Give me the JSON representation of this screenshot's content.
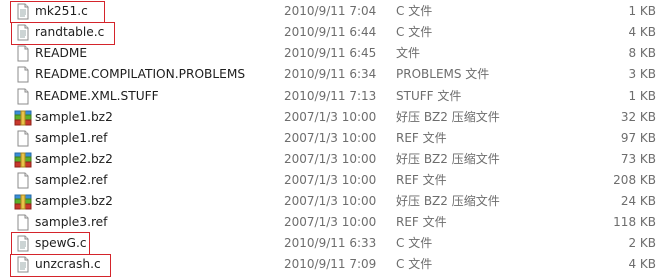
{
  "files": [
    {
      "name": "mk251.c",
      "date": "2010/9/11 7:04",
      "type": "C 文件",
      "size": "1 KB",
      "icon": "text-file-icon",
      "highlighted": true
    },
    {
      "name": "randtable.c",
      "date": "2010/9/11 6:44",
      "type": "C 文件",
      "size": "4 KB",
      "icon": "text-file-icon",
      "highlighted": true
    },
    {
      "name": "README",
      "date": "2010/9/11 6:45",
      "type": "文件",
      "size": "8 KB",
      "icon": "blank-file-icon",
      "highlighted": false
    },
    {
      "name": "README.COMPILATION.PROBLEMS",
      "date": "2010/9/11 6:34",
      "type": "PROBLEMS 文件",
      "size": "3 KB",
      "icon": "blank-file-icon",
      "highlighted": false
    },
    {
      "name": "README.XML.STUFF",
      "date": "2010/9/11 7:13",
      "type": "STUFF 文件",
      "size": "1 KB",
      "icon": "blank-file-icon",
      "highlighted": false
    },
    {
      "name": "sample1.bz2",
      "date": "2007/1/3 10:00",
      "type": "好压 BZ2 压缩文件",
      "size": "32 KB",
      "icon": "archive-icon",
      "highlighted": false
    },
    {
      "name": "sample1.ref",
      "date": "2007/1/3 10:00",
      "type": "REF 文件",
      "size": "97 KB",
      "icon": "blank-file-icon",
      "highlighted": false
    },
    {
      "name": "sample2.bz2",
      "date": "2007/1/3 10:00",
      "type": "好压 BZ2 压缩文件",
      "size": "73 KB",
      "icon": "archive-icon",
      "highlighted": false
    },
    {
      "name": "sample2.ref",
      "date": "2007/1/3 10:00",
      "type": "REF 文件",
      "size": "208 KB",
      "icon": "blank-file-icon",
      "highlighted": false
    },
    {
      "name": "sample3.bz2",
      "date": "2007/1/3 10:00",
      "type": "好压 BZ2 压缩文件",
      "size": "24 KB",
      "icon": "archive-icon",
      "highlighted": false
    },
    {
      "name": "sample3.ref",
      "date": "2007/1/3 10:00",
      "type": "REF 文件",
      "size": "118 KB",
      "icon": "blank-file-icon",
      "highlighted": false
    },
    {
      "name": "spewG.c",
      "date": "2010/9/11 6:33",
      "type": "C 文件",
      "size": "2 KB",
      "icon": "text-file-icon",
      "highlighted": true
    },
    {
      "name": "unzcrash.c",
      "date": "2010/9/11 7:09",
      "type": "C 文件",
      "size": "4 KB",
      "icon": "text-file-icon",
      "highlighted": true
    }
  ],
  "colors": {
    "highlight_border": "#d4242b",
    "name_text": "#1e1e1e",
    "meta_text": "#6d6d6d"
  }
}
